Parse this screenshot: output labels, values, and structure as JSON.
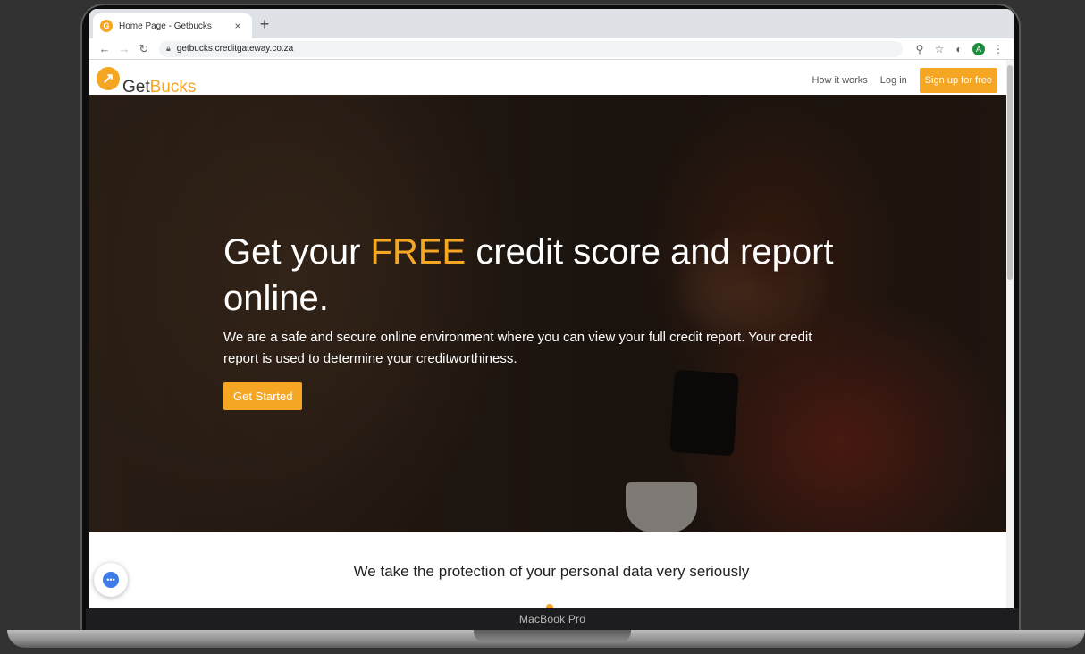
{
  "browser": {
    "tab_title": "Home Page - Getbucks",
    "tab_close": "×",
    "new_tab": "+",
    "url": "getbucks.creditgateway.co.za",
    "avatar_letter": "A"
  },
  "site": {
    "logo_get": "Get",
    "logo_bucks": "Bucks",
    "nav": {
      "how_it_works": "How it works",
      "login": "Log in",
      "signup": "Sign up for free"
    }
  },
  "hero": {
    "title_pre": "Get your ",
    "title_highlight": "FREE",
    "title_post": " credit score and report online.",
    "text": "We are a safe and secure online environment where you can view your full credit report. Your credit report is used to determine your creditworthiness.",
    "cta": "Get Started"
  },
  "section": {
    "title": "We take the protection of your personal data very seriously"
  },
  "device": {
    "label": "MacBook Pro"
  },
  "colors": {
    "brand": "#f5a623",
    "chat": "#3d7be8"
  },
  "icons": {
    "back": "arrow-left-icon",
    "forward": "arrow-right-icon",
    "reload": "reload-icon",
    "lock": "lock-icon",
    "zoom": "search-icon",
    "bookmark": "star-icon",
    "extension": "extension-icon",
    "menu": "more-vertical-icon",
    "chat": "chat-icon"
  }
}
